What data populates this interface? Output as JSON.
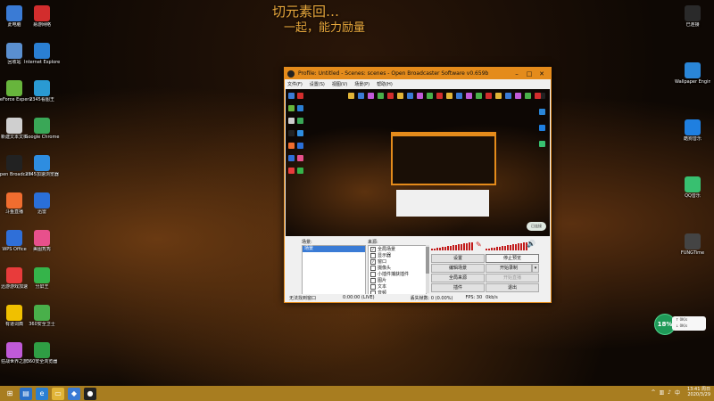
{
  "overlay": {
    "title": "切元素回…",
    "subtitle": "一起，能力励量"
  },
  "desktop_icons_left": [
    {
      "label": "此电脑",
      "icon": "computer-icon",
      "color": "#3a7bd5"
    },
    {
      "label": "回收站",
      "icon": "recycle-bin-icon",
      "color": "#5a8fcf"
    },
    {
      "label": "GeForce Experience",
      "icon": "geforce-icon",
      "color": "#67b53c"
    },
    {
      "label": "新建文本文档",
      "icon": "text-document-icon",
      "color": "#cfcfcf"
    },
    {
      "label": "Open Broadcaster...",
      "icon": "obs-icon",
      "color": "#222222"
    },
    {
      "label": "斗鱼直播",
      "icon": "douyu-icon",
      "color": "#f06d2f"
    },
    {
      "label": "WPS Office",
      "icon": "wps-icon",
      "color": "#2f6fd8"
    },
    {
      "label": "迅游游戏加速",
      "icon": "xunyou-icon",
      "color": "#e83b3b"
    },
    {
      "label": "有道词典",
      "icon": "youdao-icon",
      "color": "#f0c000"
    },
    {
      "label": "狂战世界之旅",
      "icon": "game-icon",
      "color": "#c05ad8"
    }
  ],
  "desktop_icons_col2": [
    {
      "label": "易游网络",
      "icon": "app-icon",
      "color": "#d22d2d"
    },
    {
      "label": "Internet Explorer",
      "icon": "ie-icon",
      "color": "#2a7fd3"
    },
    {
      "label": "2345看图王",
      "icon": "viewer-icon",
      "color": "#2a9ad3"
    },
    {
      "label": "Google Chrome",
      "icon": "chrome-icon",
      "color": "#3aa757"
    },
    {
      "label": "2345加速浏览器",
      "icon": "browser-icon",
      "color": "#2e8de0"
    },
    {
      "label": "迅雷",
      "icon": "thunder-icon",
      "color": "#2a6fd8"
    },
    {
      "label": "美图秀秀",
      "icon": "meitu-icon",
      "color": "#e8508c"
    },
    {
      "label": "分屏王",
      "icon": "split-icon",
      "color": "#35b44a"
    },
    {
      "label": "360安全卫士",
      "icon": "security-icon",
      "color": "#49b04a"
    },
    {
      "label": "360安全浏览器",
      "icon": "browser-360-icon",
      "color": "#2f9e44"
    }
  ],
  "desktop_icons_right": [
    {
      "label": "已连接",
      "icon": "network-icon",
      "color": "#2a2a2a"
    },
    {
      "label": "Wallpaper Engine",
      "icon": "wallpaper-icon",
      "color": "#2a86d8"
    },
    {
      "label": "酷狗音乐",
      "icon": "kugou-icon",
      "color": "#1f7fe0"
    },
    {
      "label": "QQ音乐",
      "icon": "qqmusic-icon",
      "color": "#38c070"
    },
    {
      "label": "FUNGTime",
      "icon": "fung-icon",
      "color": "#444444"
    }
  ],
  "obs": {
    "title": "Profile: Untitled - Scenes: scenes - Open Broadcaster Software v0.659b",
    "menu": [
      "文件(F)",
      "设置(S)",
      "视图(V)",
      "场景(P)",
      "帮助(H)"
    ],
    "scenes_label": "场景:",
    "sources_label": "来源:",
    "scenes": [
      "场景"
    ],
    "sources": [
      {
        "label": "全局场景",
        "checked": true
      },
      {
        "label": "显示器",
        "checked": false
      },
      {
        "label": "窗口",
        "checked": true
      },
      {
        "label": "摄像头",
        "checked": false
      },
      {
        "label": "小插件捕获插件",
        "checked": false
      },
      {
        "label": "图片",
        "checked": false
      },
      {
        "label": "文本",
        "checked": false
      },
      {
        "label": "音频",
        "checked": false
      },
      {
        "label": "其他",
        "checked": true
      }
    ],
    "buttons": {
      "settings": "设置",
      "edit_scene": "编辑场景",
      "global_sources": "全局来源",
      "plugins": "插件",
      "stop_preview": "停止预览",
      "start_recording": "开始录制",
      "start_streaming": "开始直播",
      "exit": "退出"
    },
    "status": {
      "left": "无法找到窗口",
      "timer": "0:00:00 (LIVE)",
      "dropped": "丢失帧数: 0 (0.00%)",
      "fps": "FPS: 30",
      "bitrate": "0kb/s"
    },
    "nested_badge": "已连接"
  },
  "net_widget": {
    "percent": "18%",
    "upload": "0K/s",
    "download": "0K/s"
  },
  "taskbar": {
    "time": "13:41 周日",
    "date": "2020/3/29"
  }
}
